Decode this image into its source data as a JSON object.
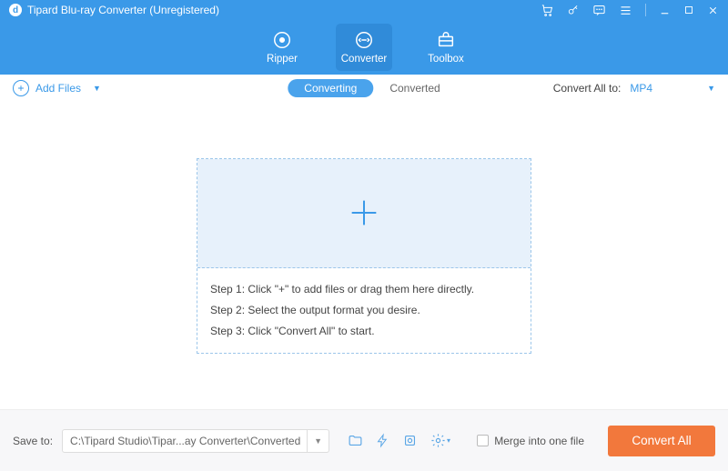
{
  "title": "Tipard Blu-ray Converter (Unregistered)",
  "modes": {
    "ripper": "Ripper",
    "converter": "Converter",
    "toolbox": "Toolbox"
  },
  "toolbar": {
    "add_files": "Add Files",
    "converting": "Converting",
    "converted": "Converted",
    "convert_all_to_label": "Convert All to:",
    "format": "MP4"
  },
  "dropzone": {
    "step1": "Step 1: Click \"+\" to add files or drag them here directly.",
    "step2": "Step 2: Select the output format you desire.",
    "step3": "Step 3: Click \"Convert All\" to start."
  },
  "footer": {
    "save_to_label": "Save to:",
    "save_path": "C:\\Tipard Studio\\Tipar...ay Converter\\Converted",
    "merge_label": "Merge into one file",
    "convert_all": "Convert All"
  }
}
